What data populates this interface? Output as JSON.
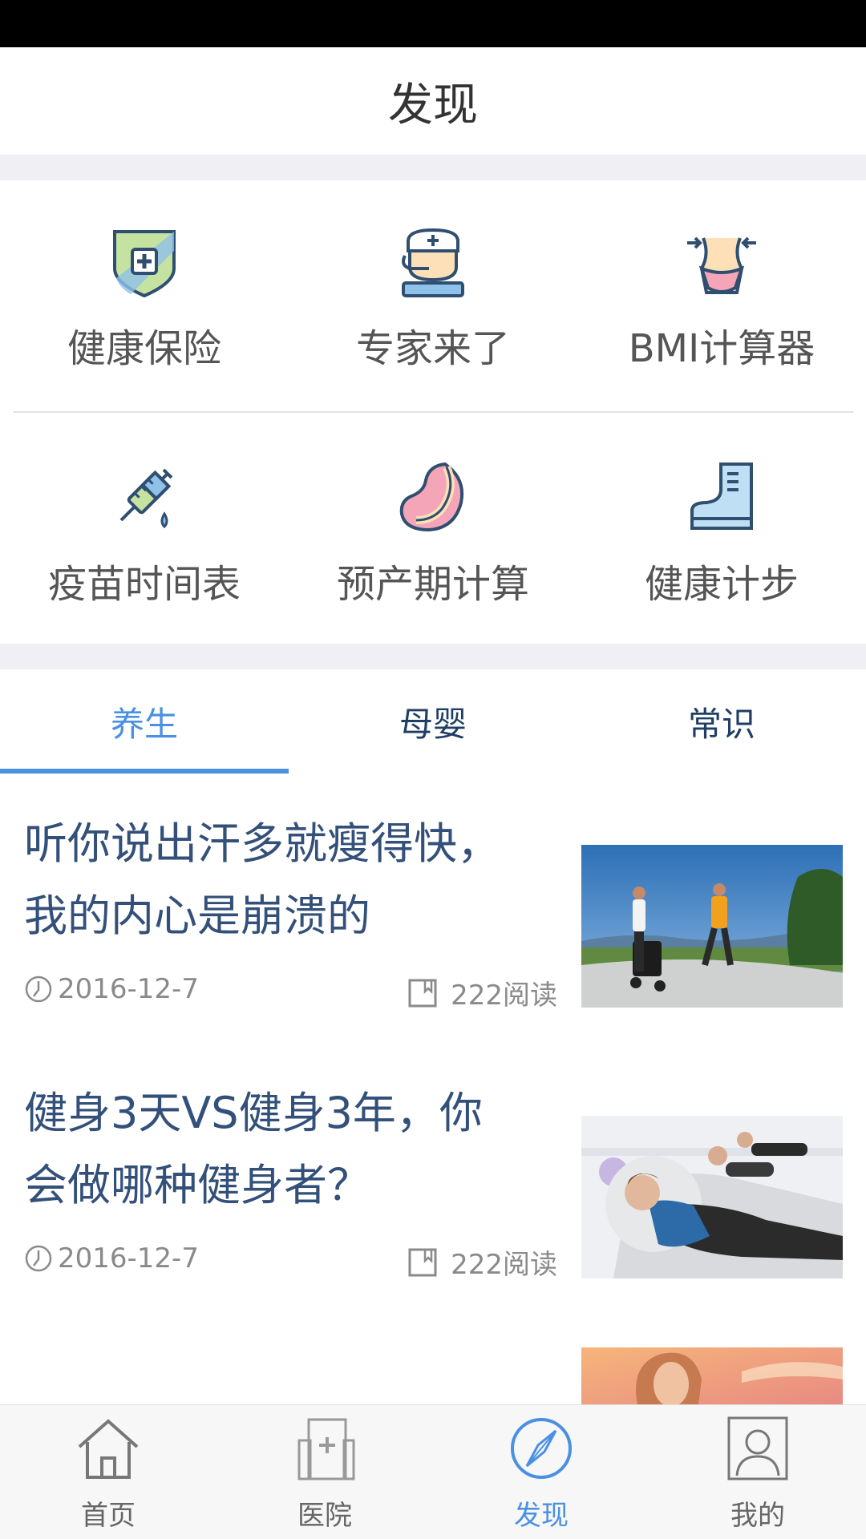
{
  "header": {
    "title": "发现"
  },
  "tools": [
    {
      "label": "健康保险",
      "icon": "shield-cross-icon"
    },
    {
      "label": "专家来了",
      "icon": "doctor-icon"
    },
    {
      "label": "BMI计算器",
      "icon": "waist-icon"
    },
    {
      "label": "疫苗时间表",
      "icon": "syringe-icon"
    },
    {
      "label": "预产期计算",
      "icon": "fetus-icon"
    },
    {
      "label": "健康计步",
      "icon": "boot-icon"
    }
  ],
  "tabs": [
    {
      "label": "养生",
      "active": true
    },
    {
      "label": "母婴",
      "active": false
    },
    {
      "label": "常识",
      "active": false
    }
  ],
  "articles": [
    {
      "title_line1": "听你说出汗多就瘦得快，",
      "title_line2": "我的内心是崩溃的",
      "date": "2016-12-7",
      "reads": "222阅读",
      "image": "joggers-photo"
    },
    {
      "title_line1": "健身3天VS健身3年，你",
      "title_line2": "会做哪种健身者？",
      "date": "2016-12-7",
      "reads": "222阅读",
      "image": "situps-photo"
    },
    {
      "image": "woman-sunset-photo"
    }
  ],
  "bottom_nav": [
    {
      "label": "首页",
      "icon": "home-icon",
      "active": false
    },
    {
      "label": "医院",
      "icon": "hospital-icon",
      "active": false
    },
    {
      "label": "发现",
      "icon": "compass-icon",
      "active": true
    },
    {
      "label": "我的",
      "icon": "profile-icon",
      "active": false
    }
  ],
  "colors": {
    "accent": "#4a90e2",
    "headline": "#33507a",
    "separator": "#efeff4"
  }
}
